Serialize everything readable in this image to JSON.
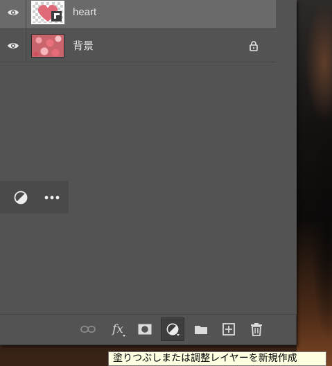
{
  "layers": [
    {
      "name": "heart",
      "visible": true,
      "selected": true,
      "locked": false,
      "thumbnail": "heart-on-transparent"
    },
    {
      "name": "背景",
      "visible": true,
      "selected": false,
      "locked": true,
      "thumbnail": "flower-photo"
    }
  ],
  "mini_toolbar": {
    "icons": [
      "adjustment-icon",
      "more-options-icon"
    ]
  },
  "bottom_toolbar": {
    "buttons": [
      {
        "name": "link-layers",
        "icon": "link-icon",
        "disabled": true
      },
      {
        "name": "add-layer-style",
        "label": "fx",
        "icon": "fx-icon"
      },
      {
        "name": "add-mask",
        "icon": "mask-icon"
      },
      {
        "name": "new-fill-adjustment-layer",
        "icon": "adjustment-icon",
        "active": true
      },
      {
        "name": "new-group",
        "icon": "folder-icon"
      },
      {
        "name": "new-layer",
        "icon": "plus-square-icon"
      },
      {
        "name": "delete-layer",
        "icon": "trash-icon"
      }
    ]
  },
  "tooltip": {
    "text": "塗りつぶしまたは調整レイヤーを新規作成"
  },
  "colors": {
    "panel_bg": "#535353",
    "selected_row": "#6a6a6a",
    "tooltip_bg": "#ffffe1"
  }
}
